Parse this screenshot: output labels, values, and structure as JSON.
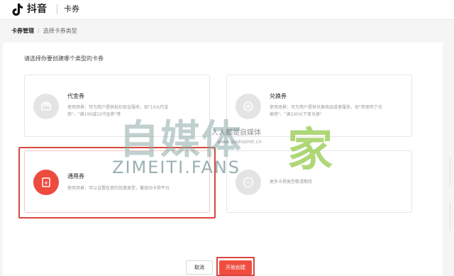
{
  "header": {
    "brand": "抖音",
    "section": "卡券"
  },
  "breadcrumb": {
    "parent": "卡券管理",
    "separator": "/",
    "current": "选择卡券类型"
  },
  "prompt": "请选择你要创建哪个类型的卡券",
  "cards": [
    {
      "title": "代金券",
      "desc": "使用场景：可为用户提供抵扣现金服务，如\"10元代金券\"、\"满100减15代金券\"等",
      "icon": "wallet-icon"
    },
    {
      "title": "兑换券",
      "desc": "使用场景：可为用户提供兑换商品或者服务，如\"赏保鸡丁兑换券\"、\"满100元下单兑换\"",
      "icon": "exchange-icon"
    },
    {
      "title": "通用券",
      "desc": "使用场景：可以设置任意的优惠类型，兼容旧卡券平台",
      "icon": "yen-ticket-icon",
      "selected": true
    },
    {
      "title": "",
      "desc": "更多卡券类型敬请期待",
      "icon": "more-icon"
    }
  ],
  "buttons": {
    "cancel": "取消",
    "start": "开始创建"
  },
  "watermark": {
    "big": "自媒体",
    "home": "家",
    "url": "ZIMEITI.FANS",
    "small_cn": "人人都是自媒体",
    "small_url": "www.yoshizimt.cn"
  },
  "colors": {
    "accent": "#f04d40",
    "highlight_frame": "#d9473c",
    "watermark": "#9fb8b4",
    "watermark_home": "#8dc63f"
  }
}
